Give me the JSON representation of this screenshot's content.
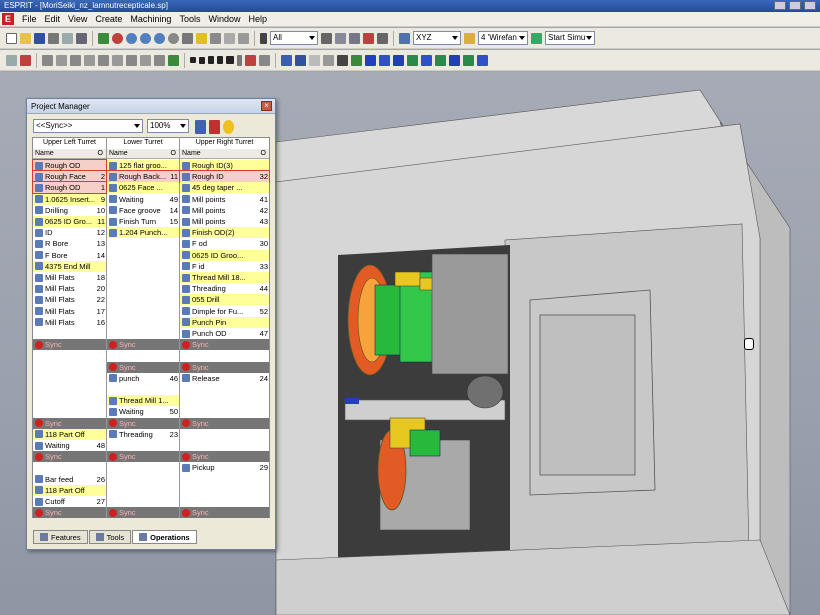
{
  "window": {
    "title": "ESPRIT - [MoriSeiki_nz_lamnutrecepticale.sp]"
  },
  "menu": [
    "File",
    "Edit",
    "View",
    "Create",
    "Machining",
    "Tools",
    "Window",
    "Help"
  ],
  "toolbar": {
    "filter_combo": "All",
    "plane_combo": "XYZ",
    "view_combo": "4 'Wirefan",
    "sim_combo": "Start Simu"
  },
  "colors": {
    "selected_border": "#d83c30",
    "highlight": "#ffff99",
    "sync_row": "#767676",
    "accent_red": "#c8201c"
  },
  "project_manager": {
    "title": "Project Manager",
    "sync_combo": "<<Sync>>",
    "zoom_combo": "100%",
    "columns": [
      {
        "header": "Upper Left Turret",
        "name_label": "Name",
        "o_label": "O",
        "rows": [
          {
            "label": "Rough OD",
            "num": "",
            "style": "sel"
          },
          {
            "label": "Rough Face",
            "num": "2",
            "style": "sel"
          },
          {
            "label": "Rough OD",
            "num": "1",
            "style": "sel"
          },
          {
            "label": "1.0625 Insert...",
            "num": "9",
            "style": "y"
          },
          {
            "label": "Drilling",
            "num": "10",
            "style": ""
          },
          {
            "label": "0625 ID Gro...",
            "num": "11",
            "style": "y"
          },
          {
            "label": "ID",
            "num": "12",
            "style": ""
          },
          {
            "label": "R Bore",
            "num": "13",
            "style": ""
          },
          {
            "label": "F Bore",
            "num": "14",
            "style": ""
          },
          {
            "label": "4375 End Mill",
            "num": "",
            "style": "y"
          },
          {
            "label": "Mill Flats",
            "num": "18",
            "style": ""
          },
          {
            "label": "Mill Flats",
            "num": "20",
            "style": ""
          },
          {
            "label": "Mill Flats",
            "num": "22",
            "style": ""
          },
          {
            "label": "Mill Flats",
            "num": "17",
            "style": ""
          },
          {
            "label": "Mill Flats",
            "num": "16",
            "style": ""
          },
          {
            "label": "",
            "num": "",
            "style": ""
          },
          {
            "label": "Sync",
            "num": "",
            "style": "sync"
          },
          {
            "label": "",
            "num": "",
            "style": ""
          },
          {
            "label": "",
            "num": "",
            "style": ""
          },
          {
            "label": "",
            "num": "",
            "style": ""
          },
          {
            "label": "",
            "num": "",
            "style": ""
          },
          {
            "label": "",
            "num": "",
            "style": ""
          },
          {
            "label": "",
            "num": "",
            "style": ""
          },
          {
            "label": "Sync",
            "num": "",
            "style": "sync"
          },
          {
            "label": "118 Part Off",
            "num": "",
            "style": "y"
          },
          {
            "label": "Waiting",
            "num": "48",
            "style": ""
          },
          {
            "label": "Sync",
            "num": "",
            "style": "sync"
          },
          {
            "label": "",
            "num": "",
            "style": ""
          },
          {
            "label": "Bar feed",
            "num": "26",
            "style": ""
          },
          {
            "label": "118 Part Off",
            "num": "",
            "style": "y"
          },
          {
            "label": "Cutoff",
            "num": "27",
            "style": ""
          },
          {
            "label": "Sync",
            "num": "",
            "style": "sync"
          }
        ]
      },
      {
        "header": "Lower Turret",
        "name_label": "Name",
        "o_label": "O",
        "rows": [
          {
            "label": "125 flat groo...",
            "num": "",
            "style": "y"
          },
          {
            "label": "Rough Back...",
            "num": "11",
            "style": "sel"
          },
          {
            "label": "0625 Face ...",
            "num": "",
            "style": "y"
          },
          {
            "label": "Waiting",
            "num": "49",
            "style": ""
          },
          {
            "label": "Face groove",
            "num": "14",
            "style": ""
          },
          {
            "label": "Finish Turn",
            "num": "15",
            "style": ""
          },
          {
            "label": "1.204 Punch...",
            "num": "",
            "style": "y"
          },
          {
            "label": "",
            "num": "",
            "style": ""
          },
          {
            "label": "",
            "num": "",
            "style": ""
          },
          {
            "label": "",
            "num": "",
            "style": ""
          },
          {
            "label": "",
            "num": "",
            "style": ""
          },
          {
            "label": "",
            "num": "",
            "style": ""
          },
          {
            "label": "",
            "num": "",
            "style": ""
          },
          {
            "label": "",
            "num": "",
            "style": ""
          },
          {
            "label": "",
            "num": "",
            "style": ""
          },
          {
            "label": "",
            "num": "",
            "style": ""
          },
          {
            "label": "Sync",
            "num": "",
            "style": "sync"
          },
          {
            "label": "",
            "num": "",
            "style": ""
          },
          {
            "label": "Sync",
            "num": "",
            "style": "sync"
          },
          {
            "label": "punch",
            "num": "46",
            "style": ""
          },
          {
            "label": "",
            "num": "",
            "style": ""
          },
          {
            "label": "Thread Mill 1...",
            "num": "",
            "style": "y"
          },
          {
            "label": "Waiting",
            "num": "50",
            "style": ""
          },
          {
            "label": "Sync",
            "num": "",
            "style": "sync"
          },
          {
            "label": "Threading",
            "num": "23",
            "style": ""
          },
          {
            "label": "",
            "num": "",
            "style": ""
          },
          {
            "label": "Sync",
            "num": "",
            "style": "sync"
          },
          {
            "label": "",
            "num": "",
            "style": ""
          },
          {
            "label": "",
            "num": "",
            "style": ""
          },
          {
            "label": "",
            "num": "",
            "style": ""
          },
          {
            "label": "",
            "num": "",
            "style": ""
          },
          {
            "label": "Sync",
            "num": "",
            "style": "sync"
          }
        ]
      },
      {
        "header": "Upper Right Turret",
        "name_label": "Name",
        "o_label": "O",
        "rows": [
          {
            "label": "Rough ID(3)",
            "num": "",
            "style": "y"
          },
          {
            "label": "Rough ID",
            "num": "32",
            "style": "sel"
          },
          {
            "label": "45 deg taper ...",
            "num": "",
            "style": "y"
          },
          {
            "label": "Mill points",
            "num": "41",
            "style": ""
          },
          {
            "label": "Mill points",
            "num": "42",
            "style": ""
          },
          {
            "label": "Mill points",
            "num": "43",
            "style": ""
          },
          {
            "label": "Finish OD(2)",
            "num": "",
            "style": "y"
          },
          {
            "label": "F od",
            "num": "30",
            "style": ""
          },
          {
            "label": "0625 ID Groo...",
            "num": "",
            "style": "y"
          },
          {
            "label": "F id",
            "num": "33",
            "style": ""
          },
          {
            "label": "Thread Mill 18...",
            "num": "",
            "style": "y"
          },
          {
            "label": "Threading",
            "num": "44",
            "style": ""
          },
          {
            "label": "055 Drill",
            "num": "",
            "style": "y"
          },
          {
            "label": "Dimple for Fu...",
            "num": "52",
            "style": ""
          },
          {
            "label": "Punch Pin",
            "num": "",
            "style": "y"
          },
          {
            "label": "Punch OD",
            "num": "47",
            "style": ""
          },
          {
            "label": "Sync",
            "num": "",
            "style": "sync"
          },
          {
            "label": "",
            "num": "",
            "style": ""
          },
          {
            "label": "Sync",
            "num": "",
            "style": "sync"
          },
          {
            "label": "Release",
            "num": "24",
            "style": ""
          },
          {
            "label": "",
            "num": "",
            "style": ""
          },
          {
            "label": "",
            "num": "",
            "style": ""
          },
          {
            "label": "",
            "num": "",
            "style": ""
          },
          {
            "label": "Sync",
            "num": "",
            "style": "sync"
          },
          {
            "label": "",
            "num": "",
            "style": ""
          },
          {
            "label": "",
            "num": "",
            "style": ""
          },
          {
            "label": "Sync",
            "num": "",
            "style": "sync"
          },
          {
            "label": "Pickup",
            "num": "29",
            "style": ""
          },
          {
            "label": "",
            "num": "",
            "style": ""
          },
          {
            "label": "",
            "num": "",
            "style": ""
          },
          {
            "label": "",
            "num": "",
            "style": ""
          },
          {
            "label": "Sync",
            "num": "",
            "style": "sync"
          }
        ]
      }
    ],
    "tabs": [
      {
        "label": "Features"
      },
      {
        "label": "Tools"
      },
      {
        "label": "Operations"
      }
    ]
  }
}
